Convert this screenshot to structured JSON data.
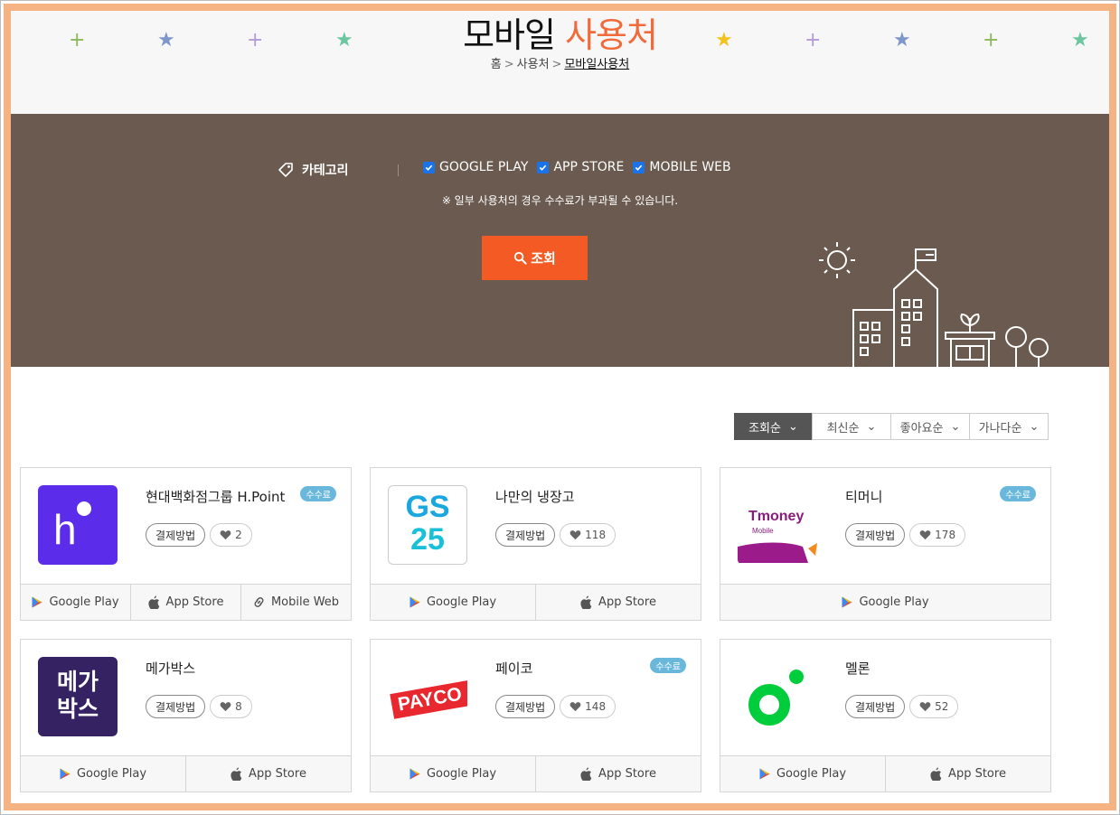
{
  "header": {
    "title_main": "모바일 ",
    "title_accent": "사용처",
    "breadcrumb": [
      "홈",
      "사용처",
      "모바일사용처"
    ],
    "decor": [
      "+",
      "★",
      "+",
      "★",
      "★",
      "+",
      "★",
      "+",
      "★"
    ]
  },
  "filter": {
    "category_label": "카테고리",
    "options": [
      "GOOGLE PLAY",
      "APP STORE",
      "MOBILE WEB"
    ],
    "note": "※ 일부 사용처의 경우 수수료가 부과될 수 있습니다.",
    "search_label": "조회"
  },
  "sort": {
    "options": [
      "조회순",
      "최신순",
      "좋아요순",
      "가나다순"
    ],
    "selected": "조회순"
  },
  "cards": [
    {
      "name": "현대백화점그룹 H.Point",
      "fee": "수수료",
      "pay_label": "결제방법",
      "likes": "2",
      "stores": [
        "Google Play",
        "App Store",
        "Mobile Web"
      ]
    },
    {
      "name": "나만의 냉장고",
      "fee": "",
      "pay_label": "결제방법",
      "likes": "118",
      "stores": [
        "Google Play",
        "App Store"
      ]
    },
    {
      "name": "티머니",
      "fee": "수수료",
      "pay_label": "결제방법",
      "likes": "178",
      "stores": [
        "Google Play"
      ]
    },
    {
      "name": "메가박스",
      "fee": "",
      "pay_label": "결제방법",
      "likes": "8",
      "stores": [
        "Google Play",
        "App Store"
      ]
    },
    {
      "name": "페이코",
      "fee": "수수료",
      "pay_label": "결제방법",
      "likes": "148",
      "stores": [
        "Google Play",
        "App Store"
      ]
    },
    {
      "name": "멜론",
      "fee": "",
      "pay_label": "결제방법",
      "likes": "52",
      "stores": [
        "Google Play",
        "App Store"
      ]
    }
  ],
  "logos": {
    "hpoint": "h",
    "gs25_top": "GS",
    "gs25_bottom": "25",
    "tmoney": "Tmoney",
    "tmoney_sub": "Mobile",
    "megabox": [
      "메가",
      "박스"
    ],
    "payco": "PAYCO"
  },
  "colors": {
    "frame_border": "#f5b383",
    "accent": "#f26a3a",
    "banner": "#6a5a4f",
    "search_button": "#f45a23",
    "fee_badge": "#69b8dc"
  },
  "icons": {
    "category": "tag-icon",
    "search": "search-icon",
    "like": "heart-icon",
    "google_play": "google-play-icon",
    "app_store": "apple-icon",
    "mobile_web": "link-icon",
    "sort_caret": "chevron-down-icon"
  }
}
